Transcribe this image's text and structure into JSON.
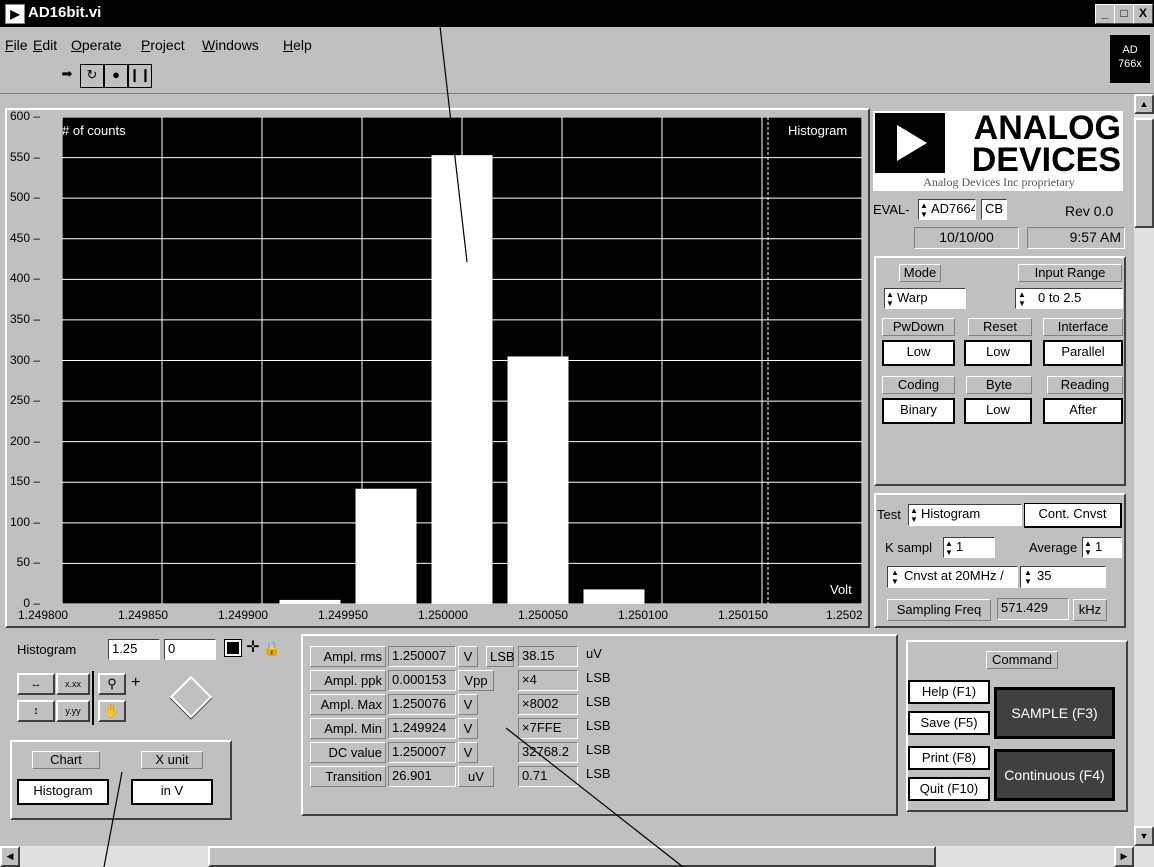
{
  "window": {
    "title": "AD16bit.vi",
    "minimize": "_",
    "maximize": "□",
    "close": "X"
  },
  "menu": [
    {
      "hot": "F",
      "rest": "ile"
    },
    {
      "hot": "E",
      "rest": "dit"
    },
    {
      "hot": "O",
      "rest": "perate"
    },
    {
      "hot": "P",
      "rest": "roject"
    },
    {
      "hot": "W",
      "rest": "indows"
    },
    {
      "hot": "H",
      "rest": "elp"
    }
  ],
  "badge": {
    "line1": "AD",
    "line2": "766x"
  },
  "chart": {
    "ylabel": "# of counts",
    "plot_label": "Histogram",
    "xlabel": "Volt",
    "y_ticks": [
      "600",
      "550",
      "500",
      "450",
      "400",
      "350",
      "300",
      "250",
      "200",
      "150",
      "100",
      "50",
      "0"
    ],
    "x_ticks": [
      "1.249800",
      "1.249850",
      "1.249900",
      "1.249950",
      "1.250000",
      "1.250050",
      "1.250100",
      "1.250150",
      "1.2502"
    ]
  },
  "chart_data": {
    "type": "bar",
    "title": "Histogram",
    "xlabel": "Volt",
    "ylabel": "# of counts",
    "xlim": [
      1.2498,
      1.2502
    ],
    "ylim": [
      0,
      600
    ],
    "grid": true,
    "x": [
      1.249924,
      1.249962,
      1.25,
      1.250038,
      1.250076
    ],
    "values": [
      5,
      142,
      553,
      305,
      18
    ]
  },
  "logo": {
    "brand1": "ANALOG",
    "brand2": "DEVICES",
    "tagline": "Analog Devices Inc proprietary"
  },
  "eval": {
    "prefix": "EVAL-",
    "part": "AD7664",
    "suffix": "CB",
    "rev": "Rev 0.0",
    "date": "10/10/00",
    "time": "9:57 AM"
  },
  "config": {
    "mode_label": "Mode",
    "mode_value": "Warp",
    "input_range_label": "Input Range",
    "input_range_value": "0 to 2.5",
    "pwdown_label": "PwDown",
    "pwdown_value": "Low",
    "reset_label": "Reset",
    "reset_value": "Low",
    "interface_label": "Interface",
    "interface_value": "Parallel",
    "coding_label": "Coding",
    "coding_value": "Binary",
    "byte_label": "Byte",
    "byte_value": "Low",
    "reading_label": "Reading",
    "reading_value": "After"
  },
  "test": {
    "test_label": "Test",
    "test_value": "Histogram",
    "cont_cnvst": "Cont. Cnvst",
    "ksampl_label": "K sampl",
    "ksampl_value": "1",
    "average_label": "Average",
    "average_value": "1",
    "cnvst_value": "Cnvst at 20MHz /",
    "divider_value": "35",
    "sampfreq_label": "Sampling Freq",
    "sampfreq_value": "571.429",
    "sampfreq_unit": "kHz"
  },
  "cursor": {
    "name": "Histogram",
    "x": "1.25",
    "y": "0"
  },
  "chart_select": {
    "chart_label": "Chart",
    "chart_value": "Histogram",
    "xunit_label": "X unit",
    "xunit_value": "in V"
  },
  "results": {
    "rows": [
      {
        "label": "Ampl. rms",
        "value": "1.250007",
        "unit": "V",
        "lsb_prefix": "LSB",
        "lsb_value": "38.15",
        "lsb_unit": "uV"
      },
      {
        "label": "Ampl. ppk",
        "value": "0.000153",
        "unit": "Vpp",
        "lsb_prefix": "",
        "lsb_value": "×4",
        "lsb_unit": "LSB"
      },
      {
        "label": "Ampl. Max",
        "value": "1.250076",
        "unit": "V",
        "lsb_prefix": "",
        "lsb_value": "×8002",
        "lsb_unit": "LSB"
      },
      {
        "label": "Ampl. Min",
        "value": "1.249924",
        "unit": "V",
        "lsb_prefix": "",
        "lsb_value": "×7FFE",
        "lsb_unit": "LSB"
      },
      {
        "label": "DC value",
        "value": "1.250007",
        "unit": "V",
        "lsb_prefix": "",
        "lsb_value": "32768.2",
        "lsb_unit": "LSB"
      },
      {
        "label": "Transition",
        "value": "26.901",
        "unit": "uV",
        "lsb_prefix": "",
        "lsb_value": "0.71",
        "lsb_unit": "LSB"
      }
    ]
  },
  "command": {
    "title": "Command",
    "help": "Help (F1)",
    "save": "Save (F5)",
    "print": "Print (F8)",
    "quit": "Quit (F10)",
    "sample": "SAMPLE (F3)",
    "continuous": "Continuous (F4)"
  },
  "palette_tools": {
    "x_fmt": "x.xx",
    "y_fmt": "y.yy",
    "zoom": "+"
  }
}
